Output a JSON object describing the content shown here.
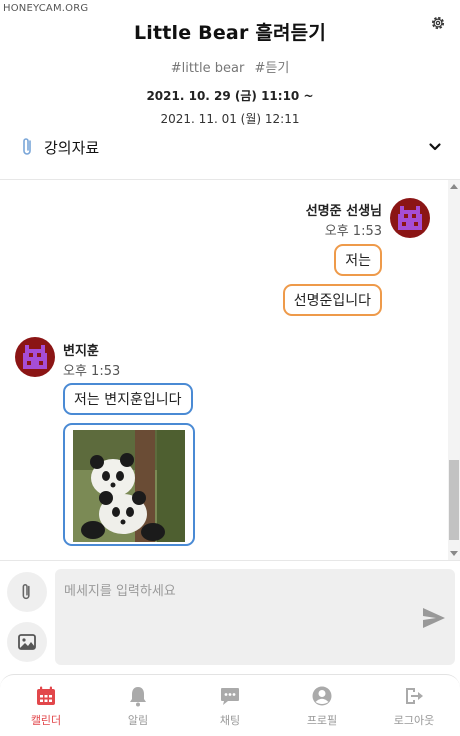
{
  "watermark": "HONEYCAM.ORG",
  "header": {
    "title": "Little Bear 흘려듣기",
    "tags": [
      "#little bear",
      "#듣기"
    ],
    "date_start": "2021. 10. 29 (금) 11:10 ~",
    "date_end": "2021. 11. 01 (월) 12:11"
  },
  "materials": {
    "label": "강의자료"
  },
  "chat": {
    "teacher": {
      "name": "선명준 선생님",
      "time": "오후 1:53",
      "messages": [
        "저는",
        "선명준입니다"
      ]
    },
    "student": {
      "name": "변지훈",
      "time": "오후 1:53",
      "messages": [
        "저는 변지훈입니다"
      ],
      "image": "panda-photo"
    }
  },
  "composer": {
    "placeholder": "메세지를 입력하세요",
    "icons": [
      "paperclip-icon",
      "image-icon",
      "send-icon"
    ]
  },
  "tabs": [
    {
      "label": "캘린더",
      "icon": "calendar-icon",
      "active": true
    },
    {
      "label": "알림",
      "icon": "bell-icon",
      "active": false
    },
    {
      "label": "채팅",
      "icon": "chat-icon",
      "active": false
    },
    {
      "label": "프로필",
      "icon": "profile-icon",
      "active": false
    },
    {
      "label": "로그아웃",
      "icon": "logout-icon",
      "active": false
    }
  ],
  "colors": {
    "teacher_bubble_border": "#ee9a4a",
    "student_bubble_border": "#4a8ad4",
    "active_tab": "#e2474b",
    "inactive_tab": "#999999",
    "avatar_bg": "#8b1515",
    "avatar_icon": "#a64dd6"
  }
}
